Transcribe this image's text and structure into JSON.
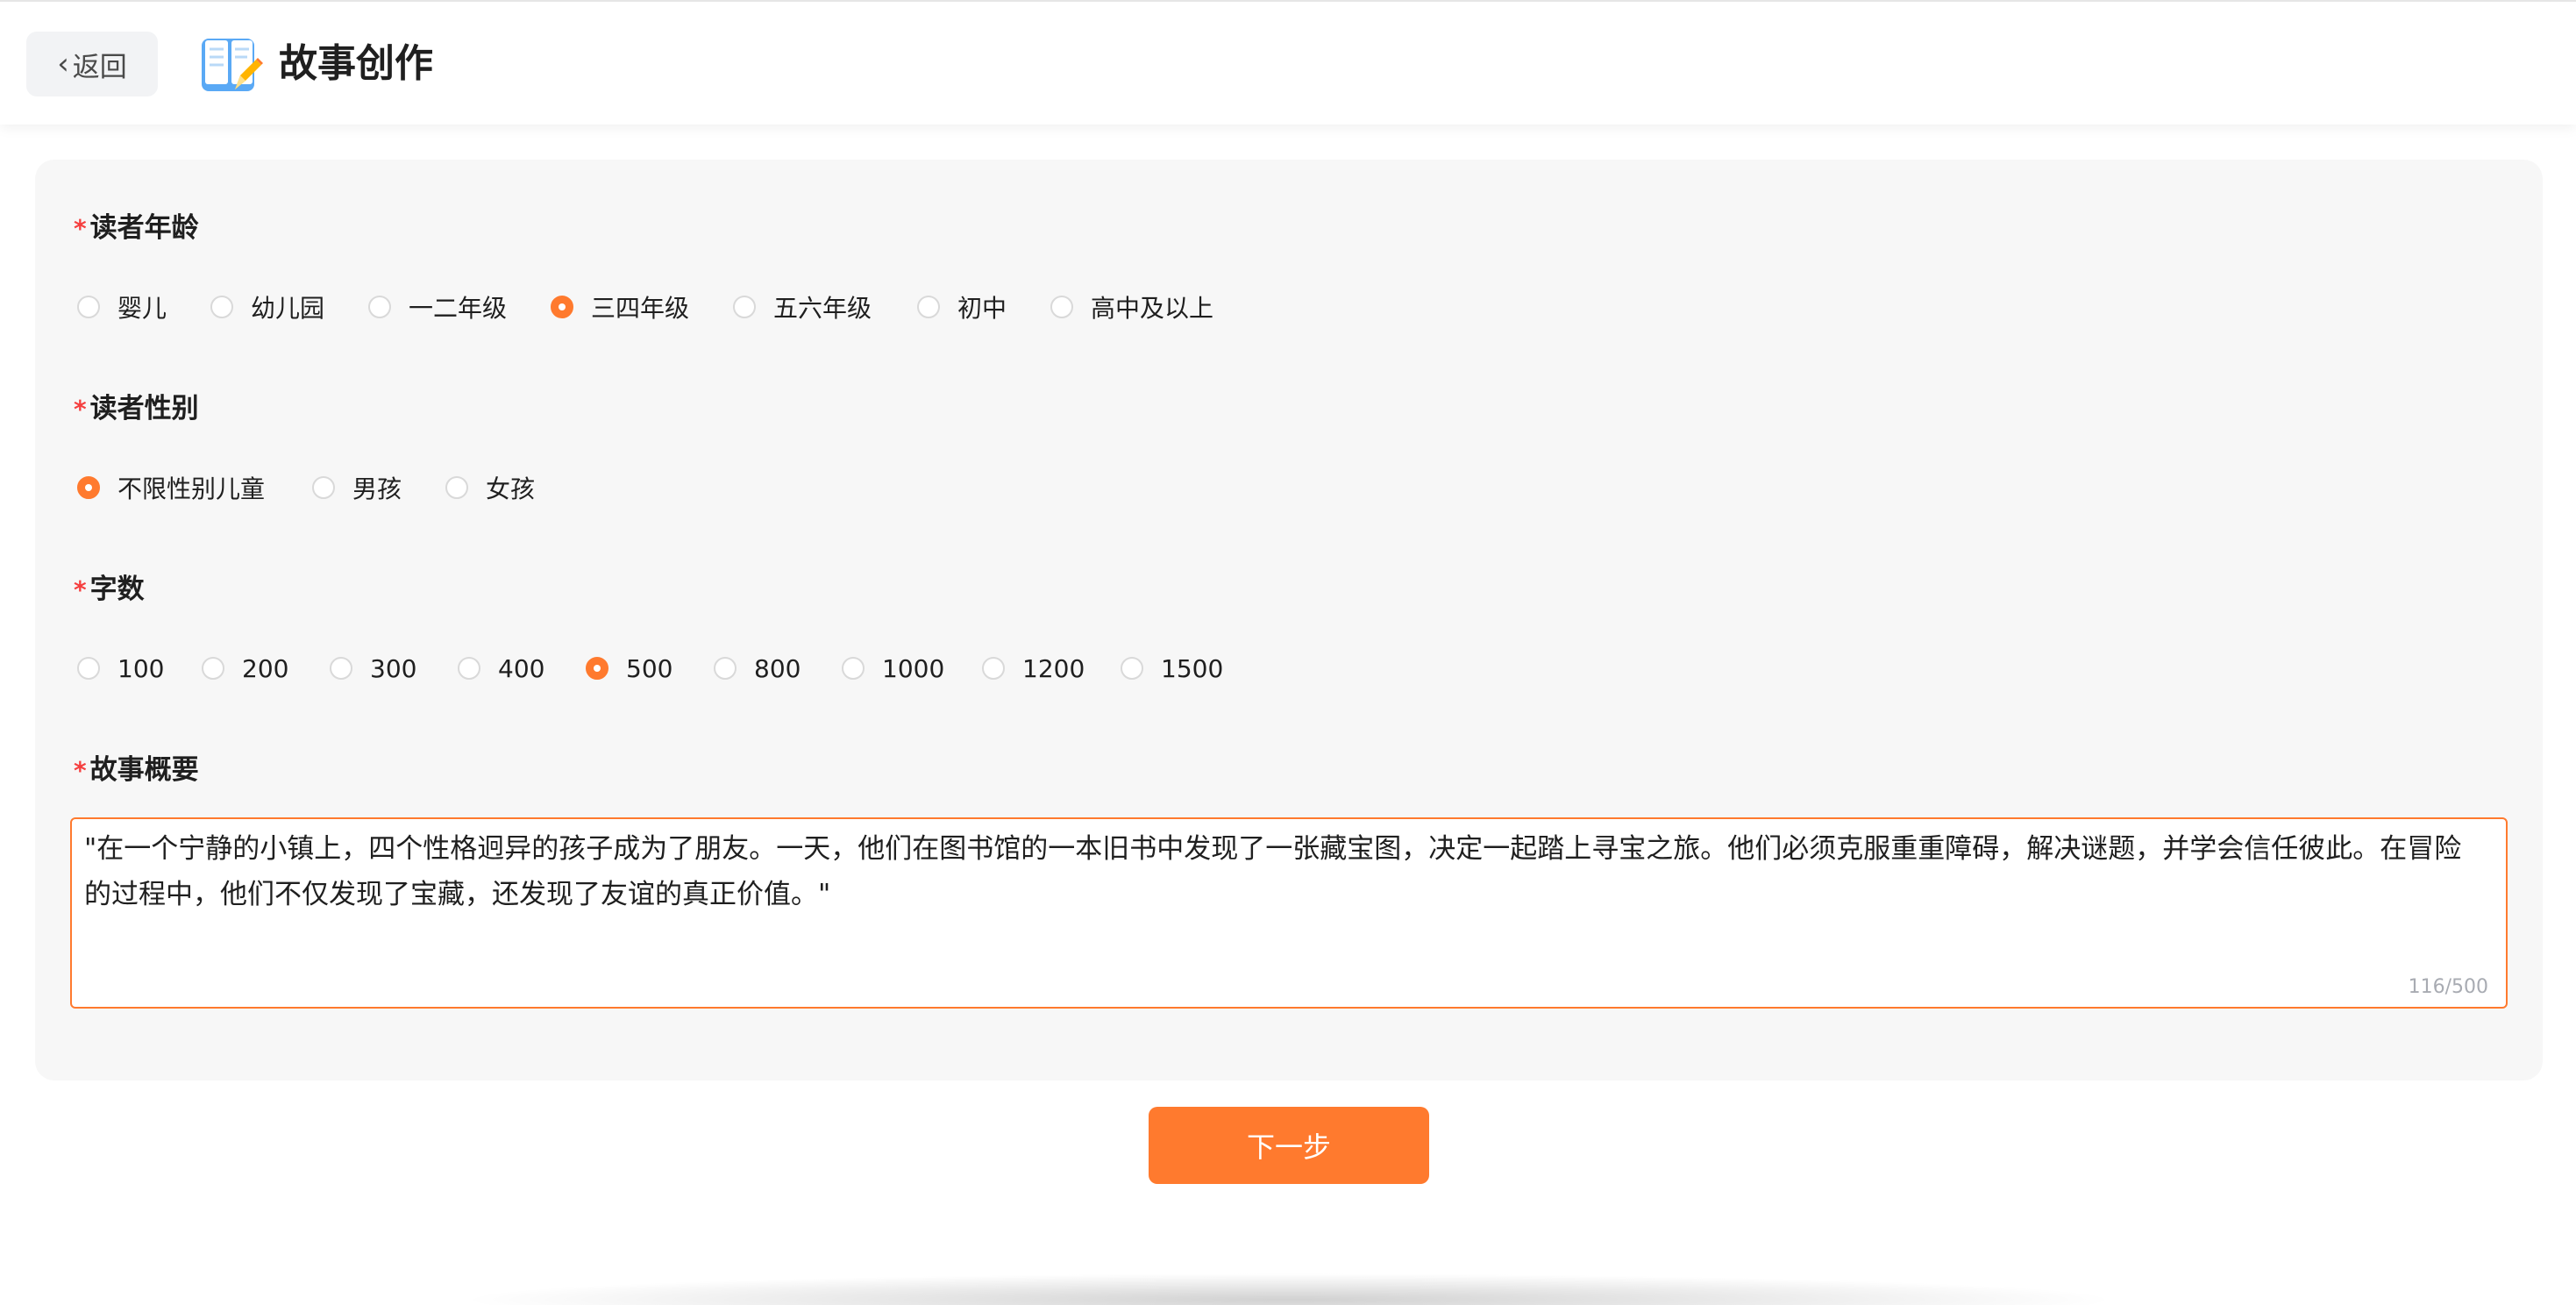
{
  "header": {
    "back_label": "返回",
    "title": "故事创作"
  },
  "form": {
    "required_mark": "*",
    "age": {
      "label": "读者年龄",
      "options": [
        "婴儿",
        "幼儿园",
        "一二年级",
        "三四年级",
        "五六年级",
        "初中",
        "高中及以上"
      ],
      "selected": "三四年级"
    },
    "gender": {
      "label": "读者性别",
      "options": [
        "不限性别儿童",
        "男孩",
        "女孩"
      ],
      "selected": "不限性别儿童"
    },
    "word_count": {
      "label": "字数",
      "options": [
        "100",
        "200",
        "300",
        "400",
        "500",
        "800",
        "1000",
        "1200",
        "1500"
      ],
      "selected": "500"
    },
    "summary": {
      "label": "故事概要",
      "value": "\"在一个宁静的小镇上，四个性格迥异的孩子成为了朋友。一天，他们在图书馆的一本旧书中发现了一张藏宝图，决定一起踏上寻宝之旅。他们必须克服重重障碍，解决谜题，并学会信任彼此。在冒险的过程中，他们不仅发现了宝藏，还发现了友谊的真正价值。\"",
      "counter": "116/500"
    }
  },
  "actions": {
    "next_label": "下一步"
  },
  "colors": {
    "accent": "#ff7a2e",
    "required": "#f53f3f"
  }
}
